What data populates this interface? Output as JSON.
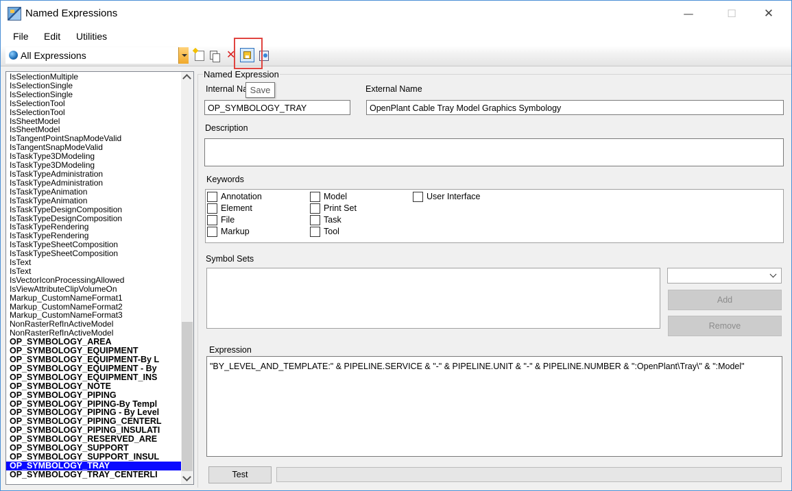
{
  "window": {
    "title": "Named Expressions",
    "min_glyph": "—",
    "max_glyph": "☐",
    "close_glyph": "✕"
  },
  "menu": [
    "File",
    "Edit",
    "Utilities"
  ],
  "toolbar": {
    "filter_value": "All Expressions",
    "delete_glyph": "✕",
    "save_tooltip": "Save",
    "icons": [
      "new-icon",
      "copy-icon",
      "delete-icon",
      "save-icon",
      "export-icon"
    ]
  },
  "list": {
    "items": [
      "IsSelectionMultiple",
      "IsSelectionSingle",
      "IsSelectionSingle",
      "IsSelectionTool",
      "IsSelectionTool",
      "IsSheetModel",
      "IsSheetModel",
      "IsTangentPointSnapModeValid",
      "IsTangentSnapModeValid",
      "IsTaskType3DModeling",
      "IsTaskType3DModeling",
      "IsTaskTypeAdministration",
      "IsTaskTypeAdministration",
      "IsTaskTypeAnimation",
      "IsTaskTypeAnimation",
      "IsTaskTypeDesignComposition",
      "IsTaskTypeDesignComposition",
      "IsTaskTypeRendering",
      "IsTaskTypeRendering",
      "IsTaskTypeSheetComposition",
      "IsTaskTypeSheetComposition",
      "IsText",
      "IsText",
      "IsVectorIconProcessingAllowed",
      "IsViewAttributeClipVolumeOn",
      "Markup_CustomNameFormat1",
      "Markup_CustomNameFormat2",
      "Markup_CustomNameFormat3",
      "NonRasterRefInActiveModel",
      "NonRasterRefInActiveModel"
    ],
    "bold_items": [
      "OP_SYMBOLOGY_AREA",
      "OP_SYMBOLOGY_EQUIPMENT",
      "OP_SYMBOLOGY_EQUIPMENT-By L",
      "OP_SYMBOLOGY_EQUIPMENT - By",
      "OP_SYMBOLOGY_EQUIPMENT_INS",
      "OP_SYMBOLOGY_NOTE",
      "OP_SYMBOLOGY_PIPING",
      "OP_SYMBOLOGY_PIPING-By Templ",
      "OP_SYMBOLOGY_PIPING - By Level",
      "OP_SYMBOLOGY_PIPING_CENTERL",
      "OP_SYMBOLOGY_PIPING_INSULATI",
      "OP_SYMBOLOGY_RESERVED_ARE",
      "OP_SYMBOLOGY_SUPPORT",
      "OP_SYMBOLOGY_SUPPORT_INSUL",
      "OP_SYMBOLOGY_TRAY",
      "OP_SYMBOLOGY_TRAY_CENTERLI"
    ],
    "selected": "OP_SYMBOLOGY_TRAY"
  },
  "form": {
    "group_title": "Named Expression",
    "internal_name_label": "Internal Na",
    "internal_name_value": "OP_SYMBOLOGY_TRAY",
    "external_name_label": "External Name",
    "external_name_value": "OpenPlant Cable Tray Model Graphics Symbology",
    "description_label": "Description",
    "description_value": "",
    "keywords_label": "Keywords",
    "keywords": [
      {
        "label": "Annotation",
        "checked": false
      },
      {
        "label": "Element",
        "checked": false
      },
      {
        "label": "File",
        "checked": false
      },
      {
        "label": "Markup",
        "checked": false
      },
      {
        "label": "Model",
        "checked": false
      },
      {
        "label": "Print Set",
        "checked": false
      },
      {
        "label": "Task",
        "checked": false
      },
      {
        "label": "Tool",
        "checked": false
      },
      {
        "label": "User Interface",
        "checked": false
      }
    ],
    "symbol_sets_label": "Symbol Sets",
    "symbol_set_select": "",
    "add_label": "Add",
    "remove_label": "Remove",
    "expression_label": "Expression",
    "expression_value": "\"BY_LEVEL_AND_TEMPLATE:\" & PIPELINE.SERVICE & \"-\" & PIPELINE.UNIT & \"-\" & PIPELINE.NUMBER & \":OpenPlant\\Tray\\\" & \":Model\"",
    "test_label": "Test"
  }
}
